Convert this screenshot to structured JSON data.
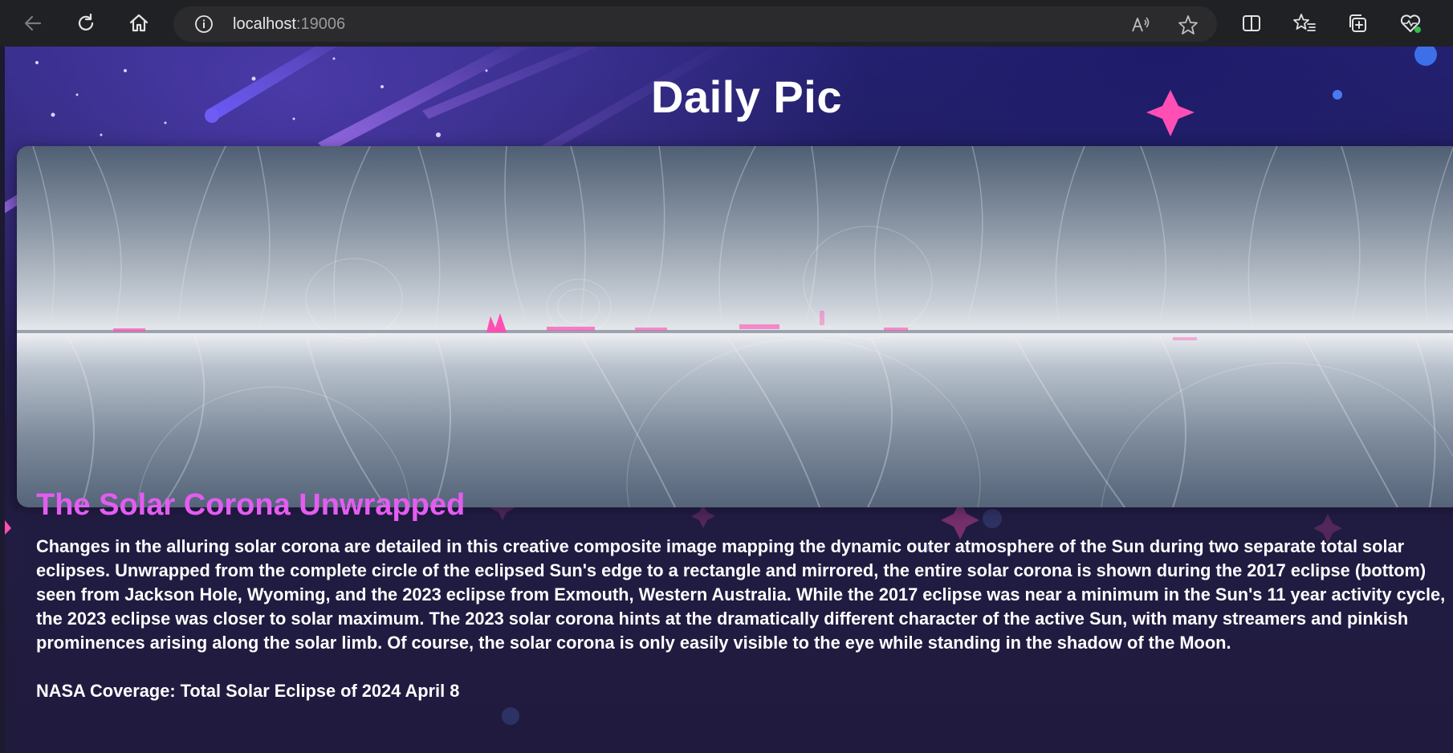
{
  "browser": {
    "url_host": "localhost",
    "url_port": ":19006",
    "icons": {
      "back": "back-arrow-icon",
      "reload": "reload-icon",
      "home": "home-icon",
      "site_info": "info-icon",
      "read_aloud": "read-aloud-icon",
      "favorite": "star-icon",
      "split_screen": "split-screen-icon",
      "favorites_list": "favorites-list-icon",
      "collections": "collections-icon",
      "browser_essentials": "heart-pulse-icon"
    }
  },
  "page": {
    "title": "Daily Pic",
    "photo": {
      "alt_subject": "solar corona composite"
    },
    "headline": "The Solar Corona Unwrapped",
    "description": "Changes in the alluring solar corona are detailed in this creative composite image mapping the dynamic outer atmosphere of the Sun during two separate total solar eclipses. Unwrapped from the complete circle of the eclipsed Sun's edge to a rectangle and mirrored, the entire solar corona is shown during the 2017 eclipse (bottom) seen from Jackson Hole, Wyoming, and the 2023 eclipse from Exmouth, Western Australia. While the 2017 eclipse was near a minimum in the Sun's 11 year activity cycle, the 2023 eclipse was closer to solar maximum. The 2023 solar corona hints at the dramatically different character of the active Sun, with many streamers and pinkish prominences arising along the solar limb. Of course, the solar corona is only easily visible to the eye while standing in the shadow of the Moon.",
    "credit": "NASA Coverage: Total Solar Eclipse of 2024 April 8"
  },
  "colors": {
    "headline": "#e45cf2",
    "text": "#ffffff",
    "chrome_bg": "#202124",
    "address_bg": "#2b2b2d",
    "prominence": "#ff4fb4"
  }
}
